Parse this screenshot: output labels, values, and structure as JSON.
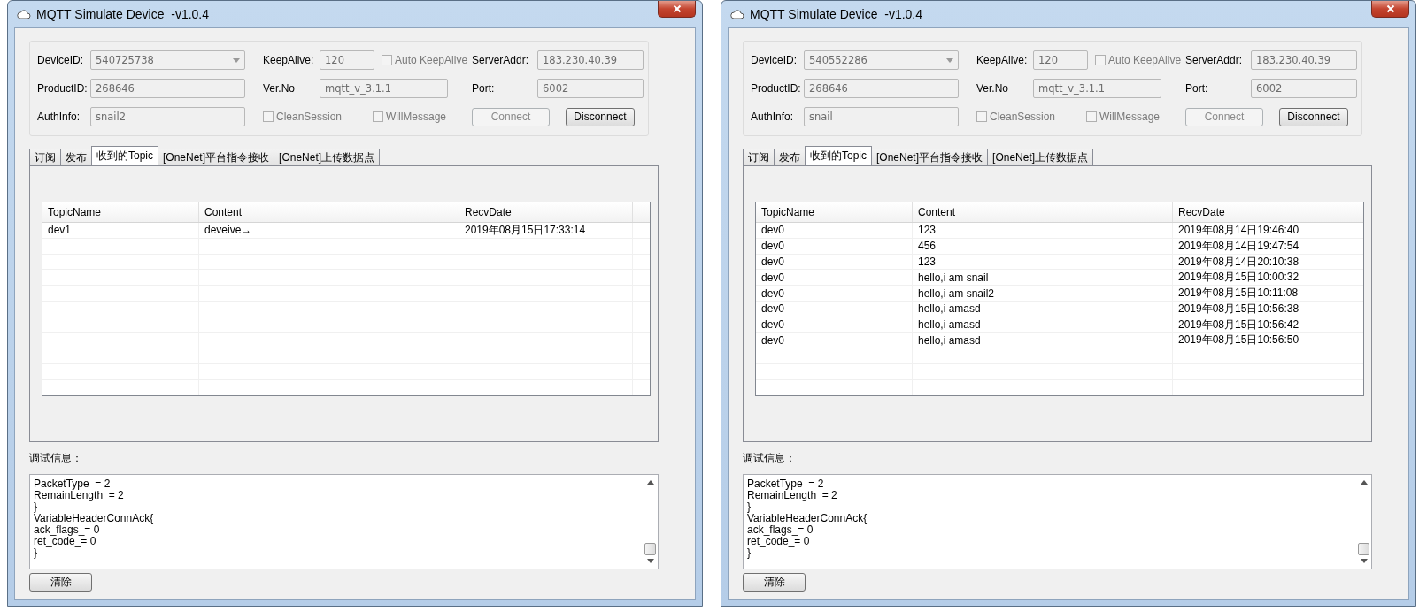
{
  "windows": [
    {
      "title": "MQTT Simulate Device  -v1.0.4",
      "fields": [
        {
          "label": "DeviceID:",
          "value": "540725738",
          "kind": "combo"
        },
        {
          "label": "ProductID:",
          "value": "268646",
          "kind": "text"
        },
        {
          "label": "AuthInfo:",
          "value": "snail2",
          "kind": "text"
        },
        {
          "label": "KeepAlive:",
          "value": "120",
          "kind": "short"
        },
        {
          "label": "Ver.No",
          "value": "mqtt_v_3.1.1",
          "kind": "text"
        },
        {
          "label": "ServerAddr:",
          "value": "183.230.40.39",
          "kind": "text"
        },
        {
          "label": "Port:",
          "value": "6002",
          "kind": "text"
        }
      ],
      "checkboxes": [
        {
          "label": "Auto KeepAlive",
          "checked": false
        },
        {
          "label": "CleanSession",
          "checked": false
        },
        {
          "label": "WillMessage",
          "checked": false
        }
      ],
      "buttons": [
        {
          "label": "Connect",
          "disabled": true
        },
        {
          "label": "Disconnect",
          "disabled": false
        }
      ],
      "tabs": [
        {
          "label": "订阅",
          "selected": false
        },
        {
          "label": "发布",
          "selected": false
        },
        {
          "label": "收到的Topic",
          "selected": true
        },
        {
          "label": "[OneNet]平台指令接收",
          "selected": false
        },
        {
          "label": "[OneNet]上传数据点",
          "selected": false
        }
      ],
      "table": {
        "columns": [
          "TopicName",
          "Content",
          "RecvDate"
        ],
        "rows": [
          [
            "dev1",
            "deveive→",
            "2019年08月15日17:33:14"
          ]
        ]
      },
      "debug_label": "调试信息：",
      "log": [
        "PacketType  = 2",
        "RemainLength  = 2",
        "}",
        "VariableHeaderConnAck{",
        "ack_flags_= 0",
        "ret_code_= 0",
        "}"
      ],
      "clear_button": "清除"
    },
    {
      "title": "MQTT Simulate Device  -v1.0.4",
      "fields": [
        {
          "label": "DeviceID:",
          "value": "540552286",
          "kind": "combo"
        },
        {
          "label": "ProductID:",
          "value": "268646",
          "kind": "text"
        },
        {
          "label": "AuthInfo:",
          "value": "snail",
          "kind": "text"
        },
        {
          "label": "KeepAlive:",
          "value": "120",
          "kind": "short"
        },
        {
          "label": "Ver.No",
          "value": "mqtt_v_3.1.1",
          "kind": "text"
        },
        {
          "label": "ServerAddr:",
          "value": "183.230.40.39",
          "kind": "text"
        },
        {
          "label": "Port:",
          "value": "6002",
          "kind": "text"
        }
      ],
      "checkboxes": [
        {
          "label": "Auto KeepAlive",
          "checked": false
        },
        {
          "label": "CleanSession",
          "checked": false
        },
        {
          "label": "WillMessage",
          "checked": false
        }
      ],
      "buttons": [
        {
          "label": "Connect",
          "disabled": true
        },
        {
          "label": "Disconnect",
          "disabled": false
        }
      ],
      "tabs": [
        {
          "label": "订阅",
          "selected": false
        },
        {
          "label": "发布",
          "selected": false
        },
        {
          "label": "收到的Topic",
          "selected": true
        },
        {
          "label": "[OneNet]平台指令接收",
          "selected": false
        },
        {
          "label": "[OneNet]上传数据点",
          "selected": false
        }
      ],
      "table": {
        "columns": [
          "TopicName",
          "Content",
          "RecvDate"
        ],
        "rows": [
          [
            "dev0",
            "123",
            "2019年08月14日19:46:40"
          ],
          [
            "dev0",
            "456",
            "2019年08月14日19:47:54"
          ],
          [
            "dev0",
            "123",
            "2019年08月14日20:10:38"
          ],
          [
            "dev0",
            "hello,i am snail",
            "2019年08月15日10:00:32"
          ],
          [
            "dev0",
            "hello,i am snail2",
            "2019年08月15日10:11:08"
          ],
          [
            "dev0",
            "hello,i amasd",
            "2019年08月15日10:56:38"
          ],
          [
            "dev0",
            "hello,i amasd",
            "2019年08月15日10:56:42"
          ],
          [
            "dev0",
            "hello,i amasd",
            "2019年08月15日10:56:50"
          ]
        ]
      },
      "debug_label": "调试信息：",
      "log": [
        "PacketType  = 2",
        "RemainLength  = 2",
        "}",
        "VariableHeaderConnAck{",
        "ack_flags_= 0",
        "ret_code_= 0",
        "}"
      ],
      "clear_button": "清除"
    }
  ]
}
